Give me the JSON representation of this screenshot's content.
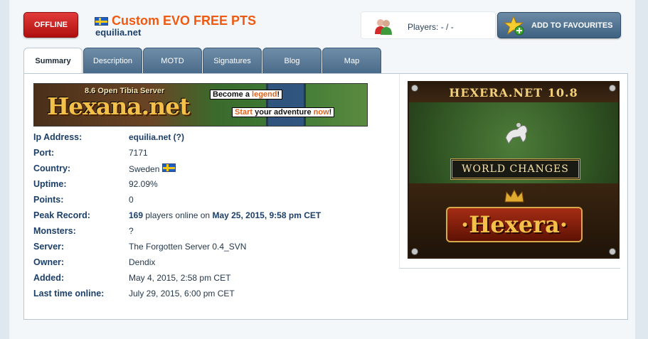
{
  "header": {
    "status": "OFFLINE",
    "title": "Custom EVO FREE PTS",
    "domain": "equilia.net",
    "players_label": "Players:",
    "players_value": "- / -",
    "fav_label": "ADD TO FAVOURITES"
  },
  "tabs": [
    {
      "label": "Summary",
      "active": true
    },
    {
      "label": "Description",
      "active": false
    },
    {
      "label": "MOTD",
      "active": false
    },
    {
      "label": "Signatures",
      "active": false
    },
    {
      "label": "Blog",
      "active": false
    },
    {
      "label": "Map",
      "active": false
    }
  ],
  "banner": {
    "subtitle": "8.6 Open Tibia Server",
    "logo": "Hexana.net",
    "line1_a": "Become a ",
    "line1_b": "legend",
    "line1_c": "!",
    "line2_a": "Start",
    "line2_b": " your adventure ",
    "line2_c": "now",
    "line2_d": "!"
  },
  "info": {
    "ip_label": "Ip Address:",
    "ip_value": "equilia.net (?)",
    "port_label": "Port:",
    "port_value": "7171",
    "country_label": "Country:",
    "country_value": "Sweden",
    "uptime_label": "Uptime:",
    "uptime_value": "92.09%",
    "points_label": "Points:",
    "points_value": "0",
    "peak_label": "Peak Record:",
    "peak_count": "169",
    "peak_mid": "players online on",
    "peak_date": "May 25, 2015, 9:58 pm CET",
    "monsters_label": "Monsters:",
    "monsters_value": "?",
    "server_label": "Server:",
    "server_value": "The Forgotten Server 0.4_SVN",
    "owner_label": "Owner:",
    "owner_value": "Dendix",
    "added_label": "Added:",
    "added_value": "May 4, 2015, 2:58 pm CET",
    "lastonline_label": "Last time online:",
    "lastonline_value": "July 29, 2015, 6:00 pm CET"
  },
  "ad": {
    "top": "HEXERA.NET 10.8",
    "world": "WORLD CHANGES",
    "logo": "·Hexera·"
  },
  "colors": {
    "accent_title": "#ef5a12",
    "label_blue": "#1c3f69",
    "status_red": "#c41a1a",
    "tab_blue": "#5a7a98"
  },
  "icons": {
    "status": "offline-badge",
    "players": "players-icon",
    "favourite": "star-add-icon",
    "flag": "sweden-flag-icon"
  }
}
